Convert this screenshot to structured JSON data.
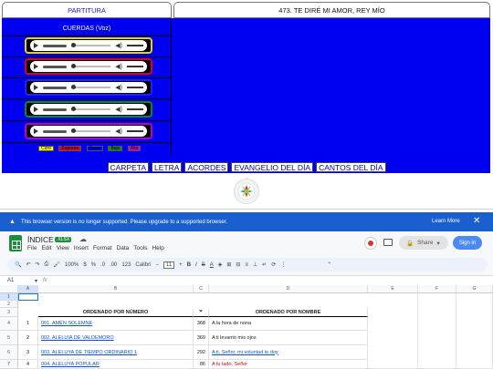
{
  "web": {
    "left_header": "PARTITURA",
    "right_header": "473. TE DIRÉ MI AMOR, REY MÍO",
    "cuerdas_label": "CUERDAS (Voz)",
    "players": [
      {
        "border": "#f0d000"
      },
      {
        "border": "#e0001c"
      },
      {
        "border": "#2222ff"
      },
      {
        "border": "#0a8a2a"
      },
      {
        "border": "#c000c0"
      }
    ],
    "swatches": [
      {
        "label": "Coro",
        "color": "#ffff00"
      },
      {
        "label": "Soprano",
        "color": "#e0001c"
      },
      {
        "label": "Tenor",
        "color": "#0000ff"
      },
      {
        "label": "Bajo",
        "color": "#0a8a2a"
      },
      {
        "label": "Alto",
        "color": "#d000d0"
      }
    ],
    "menu": [
      "CARPETA",
      "LETRA",
      "ACORDES",
      "EVANGELIO DEL DÍA",
      "CANTOS DEL DÍA"
    ]
  },
  "banner": {
    "message": "This browser version is no longer supported. Please upgrade to a supported browser.",
    "learn_more": "Learn More",
    "close": "✕"
  },
  "sheet": {
    "title": "ÍNDICE",
    "badge": ".XLSX",
    "menus": [
      "File",
      "Edit",
      "View",
      "Insert",
      "Format",
      "Data",
      "Tools",
      "Help"
    ],
    "share": "Share",
    "signin": "Sign in",
    "toolbar": {
      "zoom": "100%",
      "currency": "$",
      "percent": "%",
      "dec_dec": ".0",
      "inc_dec": ".00",
      "fmt": "123",
      "font": "Calibri",
      "size": "11"
    },
    "namebox": "A1",
    "fx": "fx",
    "columns": [
      "A",
      "B",
      "C",
      "D",
      "E",
      "F",
      "G"
    ],
    "rows": [
      "1",
      "2",
      "3",
      "4",
      "5",
      "6",
      "7"
    ],
    "header_left": "ORDENADO POR NÚMERO",
    "header_right": "ORDENADO POR NOMBRE",
    "data": [
      {
        "n": "1",
        "title": "001. AMÉN SOLEMNE",
        "num": "368",
        "name": "A la hora de nona",
        "name_style": "plain"
      },
      {
        "n": "2",
        "title": "002. ALELUIA DE VALDEMORO",
        "num": "369",
        "name": "A ti levanto mis ojos",
        "name_style": "plain"
      },
      {
        "n": "3",
        "title": "003. ALELUYA DE TIEMPO ORDINARIO 1",
        "num": "292",
        "name": "A ti, Señor, mi voluntad te doy",
        "name_style": "link"
      },
      {
        "n": "4",
        "title": "004. ALELUYA POPULAR",
        "num": "86",
        "name": "A tu lado, Señor",
        "name_style": "red"
      }
    ]
  }
}
